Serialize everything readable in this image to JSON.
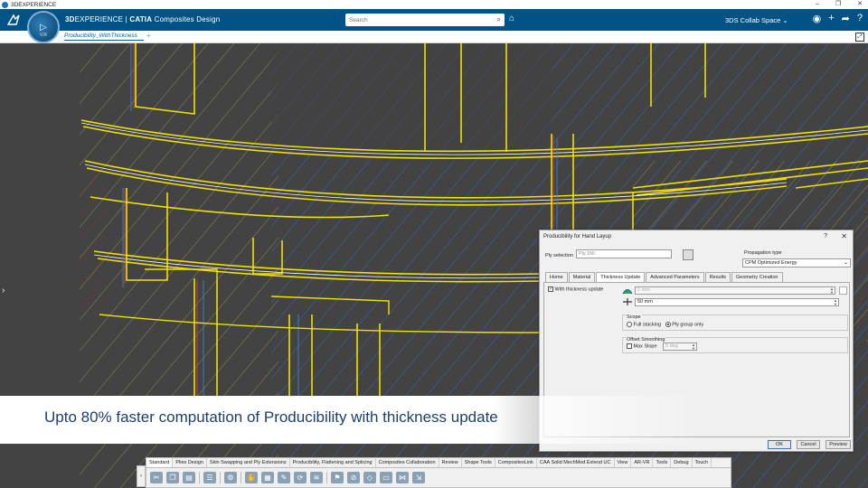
{
  "os_bar": {
    "title": "3DEXPERIENCE",
    "controls": [
      "–",
      "❐",
      "✕"
    ]
  },
  "header": {
    "brand_bold": "3D",
    "brand_rest": "EXPERIENCE | ",
    "brand_catia": "CATIA",
    "brand_app": " Composites Design",
    "compass_version": "V.R",
    "search": {
      "placeholder": "Search"
    },
    "collab_space": "3DS Collab Space ⌄"
  },
  "tab_strip": {
    "doc_tab": "Producibility_WithThickness",
    "add_tab": "+"
  },
  "dialog": {
    "title": "Producibility for Hand Layup",
    "help": "?",
    "close": "✕",
    "ply_selection_label": "Ply selection",
    "ply_selection_value": "Ply.160",
    "propagation_label": "Propagation type",
    "propagation_value": "CPM Optimized Energy",
    "tabs": [
      "Home",
      "Material",
      "Thickness Update",
      "Advanced Parameters",
      "Results",
      "Geometry Creation"
    ],
    "active_tab": "Thickness Update",
    "with_thickness_label": "With thickness update",
    "with_thickness_checked": true,
    "thickness_value": "1 mm",
    "distance_value": "50 mm",
    "scope_label": "Scope",
    "scope_options": [
      "Full stacking",
      "Ply group only"
    ],
    "scope_selected": "Ply group only",
    "offset_label": "Offset Smoothing",
    "max_slope_label": "Max Slope",
    "max_slope_value": "5 deg",
    "buttons": {
      "ok": "OK",
      "cancel": "Cancel",
      "preview": "Preview"
    }
  },
  "caption": {
    "text": "Upto 80% faster computation of Producibility with thickness update"
  },
  "action_bar": {
    "tabs": [
      "Standard",
      "Plies Design",
      "Skin Swapping and Ply Extensions",
      "Producibility, Flattening and Splicing",
      "Composites Collaboration",
      "Review",
      "Shape Tools",
      "CompositesLink",
      "CAA Solid MechMod Extend UC",
      "View",
      "AR-VR",
      "Tools",
      "Debug",
      "Touch"
    ],
    "active_tab": "Standard"
  },
  "colors": {
    "header_bg": "#005386",
    "viewport_bg": "#434343",
    "caption_text": "#1e3f6d",
    "curve_yellow": "#f2e000",
    "curve_blue": "#3a7fd6",
    "curve_red": "#c0392b"
  }
}
